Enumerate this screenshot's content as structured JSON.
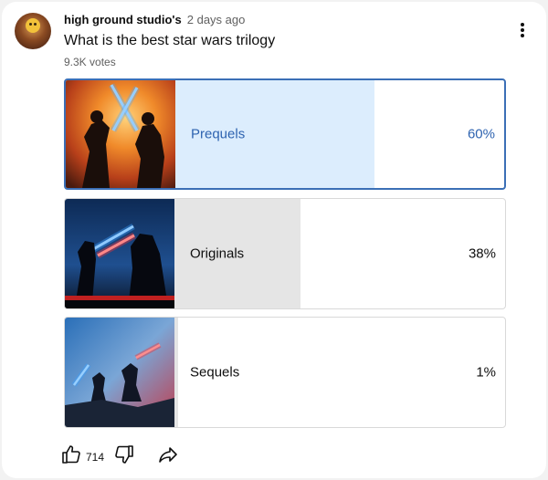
{
  "post": {
    "author": "high ground studio's",
    "time": "2 days ago",
    "question": "What is the best star wars trilogy",
    "votes": "9.3K votes"
  },
  "options": [
    {
      "label": "Prequels",
      "percent_text": "60%",
      "share": 0.6,
      "selected": true,
      "image": "anakin-obiwan-duel-thumbnail"
    },
    {
      "label": "Originals",
      "percent_text": "38%",
      "share": 0.38,
      "selected": false,
      "image": "luke-vader-duel-thumbnail"
    },
    {
      "label": "Sequels",
      "percent_text": "1%",
      "share": 0.01,
      "selected": false,
      "image": "rey-kylo-battle-thumbnail"
    }
  ],
  "actions": {
    "like_count": "714",
    "icons": [
      "thumbs-up-icon",
      "thumbs-down-icon",
      "share-icon"
    ]
  },
  "colors": {
    "selected_border": "#3b6fb6",
    "selected_fill": "#dcedfd",
    "unselected_fill": "#e5e5e5",
    "selected_text": "#2e63b0"
  }
}
